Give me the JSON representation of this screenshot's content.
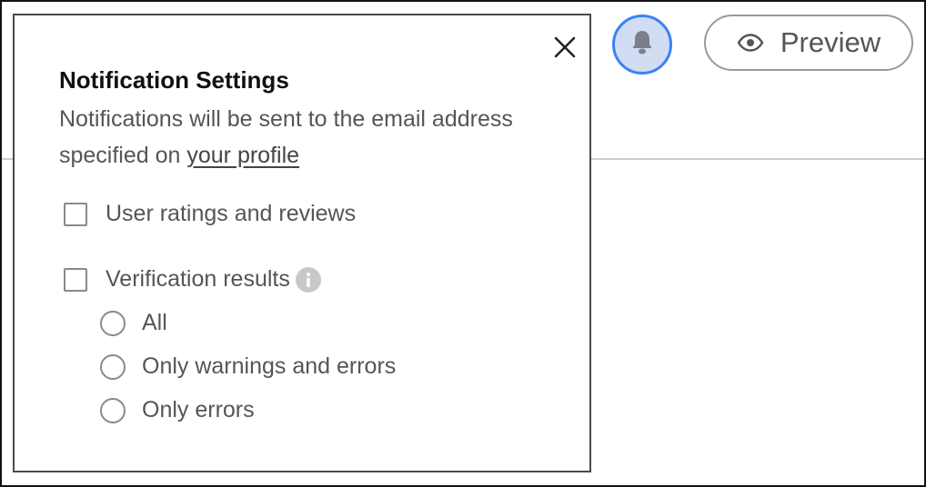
{
  "header": {
    "bell_icon": "bell-icon",
    "preview": {
      "label": "Preview",
      "icon": "eye-icon"
    }
  },
  "notification_settings": {
    "title": "Notification Settings",
    "description_prefix": "Notifications will be sent to the email address specified on ",
    "profile_link": "your profile",
    "close_icon": "close-icon",
    "checkboxes": [
      {
        "label": "User ratings and reviews",
        "checked": false
      },
      {
        "label": "Verification results",
        "checked": false,
        "info_icon": "info-icon"
      }
    ],
    "radio_options": [
      {
        "label": "All",
        "selected": false
      },
      {
        "label": "Only warnings and errors",
        "selected": false
      },
      {
        "label": "Only errors",
        "selected": false
      }
    ]
  },
  "colors": {
    "bell_accent": "#3b82f6",
    "bell_fill": "#d2dcf2",
    "text_primary": "#111111",
    "text_secondary": "#555555"
  }
}
